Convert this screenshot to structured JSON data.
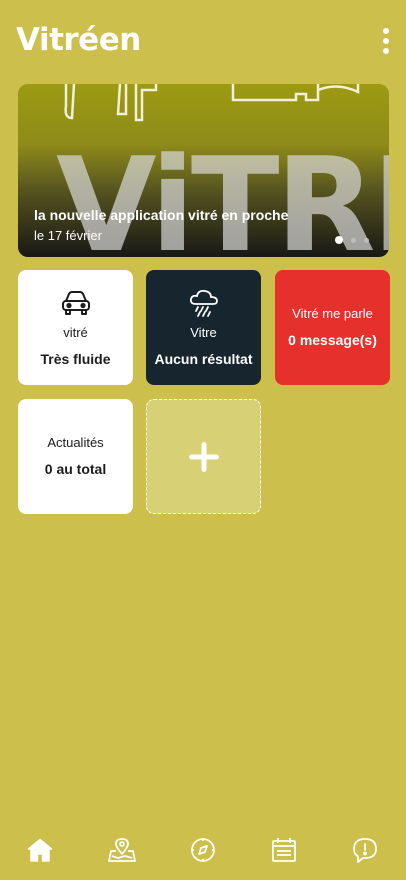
{
  "header": {
    "title": "Vitréen"
  },
  "banner": {
    "art_text": "ViTRE",
    "headline": "la nouvelle application vitré en proche",
    "date": "le 17 février",
    "dot_count": 3,
    "active_dot": 1
  },
  "tiles": [
    {
      "icon": "car-icon",
      "label": "vitré",
      "value": "Très fluide",
      "color": "#ffffff"
    },
    {
      "icon": "rain-cloud-icon",
      "label": "Vitre",
      "value": "Aucun résultat",
      "color": "#17252f"
    },
    {
      "icon": "",
      "label": "Vitré me parle",
      "value": "0 message(s)",
      "color": "#e5302c"
    },
    {
      "icon": "",
      "label": "Actualités",
      "value": "0 au total",
      "color": "#ffffff"
    }
  ],
  "add_tile": {
    "icon": "plus-icon"
  },
  "bottom_nav": [
    {
      "icon": "home-icon",
      "active": true
    },
    {
      "icon": "map-pin-icon",
      "active": false
    },
    {
      "icon": "compass-icon",
      "active": false
    },
    {
      "icon": "calendar-icon",
      "active": false
    },
    {
      "icon": "alert-chat-icon",
      "active": false
    }
  ],
  "colors": {
    "background": "#cdbf4b",
    "dark": "#17252f",
    "red": "#e5302c",
    "white": "#ffffff"
  }
}
